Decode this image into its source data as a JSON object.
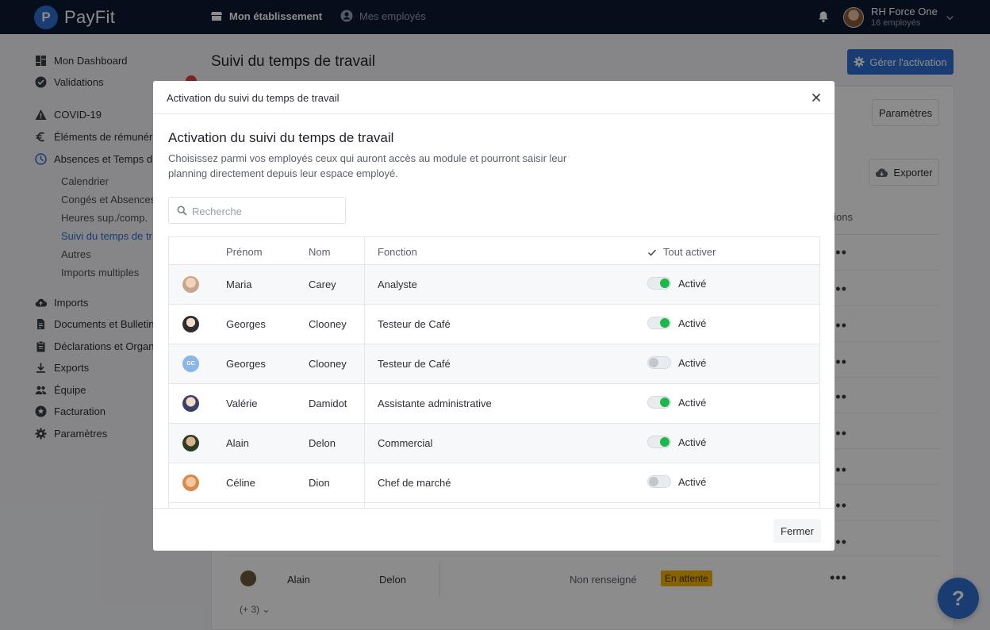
{
  "topbar": {
    "logo_text": "PayFit",
    "nav": [
      {
        "label": "Mon établissement"
      },
      {
        "label": "Mes employés"
      }
    ],
    "user": {
      "name": "RH Force One",
      "subtitle": "16 employés"
    }
  },
  "sidebar": {
    "items": [
      {
        "label": "Mon Dashboard",
        "icon": "dashboard-icon"
      },
      {
        "label": "Validations",
        "icon": "check-circle-icon"
      },
      {
        "label": "COVID-19",
        "icon": "warning-icon"
      },
      {
        "label": "Éléments de rémunéra",
        "icon": "euro-icon"
      },
      {
        "label": "Absences et Temps d",
        "icon": "clock-icon"
      },
      {
        "label": "Imports",
        "icon": "cloud-upload-icon"
      },
      {
        "label": "Documents et Bulletin",
        "icon": "document-icon"
      },
      {
        "label": "Déclarations et Organ",
        "icon": "clipboard-icon"
      },
      {
        "label": "Exports",
        "icon": "download-icon"
      },
      {
        "label": "Équipe",
        "icon": "team-icon"
      },
      {
        "label": "Facturation",
        "icon": "billing-icon"
      },
      {
        "label": "Paramètres",
        "icon": "gear-icon"
      }
    ],
    "subitems": [
      {
        "label": "Calendrier"
      },
      {
        "label": "Congés et Absences"
      },
      {
        "label": "Heures sup./comp."
      },
      {
        "label": "Suivi du temps de tr"
      },
      {
        "label": "Autres"
      },
      {
        "label": "Imports multiples"
      }
    ]
  },
  "page": {
    "title": "Suivi du temps de travail",
    "primary_button": "Gérer l'activation",
    "settings_button": "Paramètres",
    "export_button": "Exporter",
    "actions_header": "ctions",
    "last_row": {
      "first": "Alain",
      "last": "Delon",
      "status": "Non renseigné",
      "badge": "En attente"
    },
    "more_rows": "(+ 3)"
  },
  "modal": {
    "header_title": "Activation du suivi du temps de travail",
    "title": "Activation du suivi du temps de travail",
    "description": "Choisissez parmi vos employés ceux qui auront accès au module et pourront saisir leur planning directement depuis leur espace employé.",
    "search_placeholder": "Recherche",
    "columns": {
      "first": "Prénom",
      "last": "Nom",
      "role": "Fonction",
      "toggle_all": "Tout activer"
    },
    "rows": [
      {
        "first": "Maria",
        "last": "Carey",
        "role": "Analyste",
        "active": true,
        "status": "Activé",
        "avatar_color": "#c9a58c"
      },
      {
        "first": "Georges",
        "last": "Clooney",
        "role": "Testeur de Café",
        "active": true,
        "status": "Activé",
        "avatar_color": "#5a5a5a"
      },
      {
        "first": "Georges",
        "last": "Clooney",
        "role": "Testeur de Café",
        "active": false,
        "status": "Activé",
        "avatar_color": "#8ab6e8",
        "initials": "GC"
      },
      {
        "first": "Valérie",
        "last": "Damidot",
        "role": "Assistante administrative",
        "active": true,
        "status": "Activé",
        "avatar_color": "#b98f7a"
      },
      {
        "first": "Alain",
        "last": "Delon",
        "role": "Commercial",
        "active": true,
        "status": "Activé",
        "avatar_color": "#6b5a3a"
      },
      {
        "first": "Céline",
        "last": "Dion",
        "role": "Chef de marché",
        "active": false,
        "status": "Activé",
        "avatar_color": "#e09a6a"
      }
    ],
    "close_button": "Fermer"
  },
  "colors": {
    "accent": "#2f6fd1",
    "toggle_on": "#1fb64c",
    "topbar": "#0b1a33",
    "badge": "#f4b400"
  }
}
